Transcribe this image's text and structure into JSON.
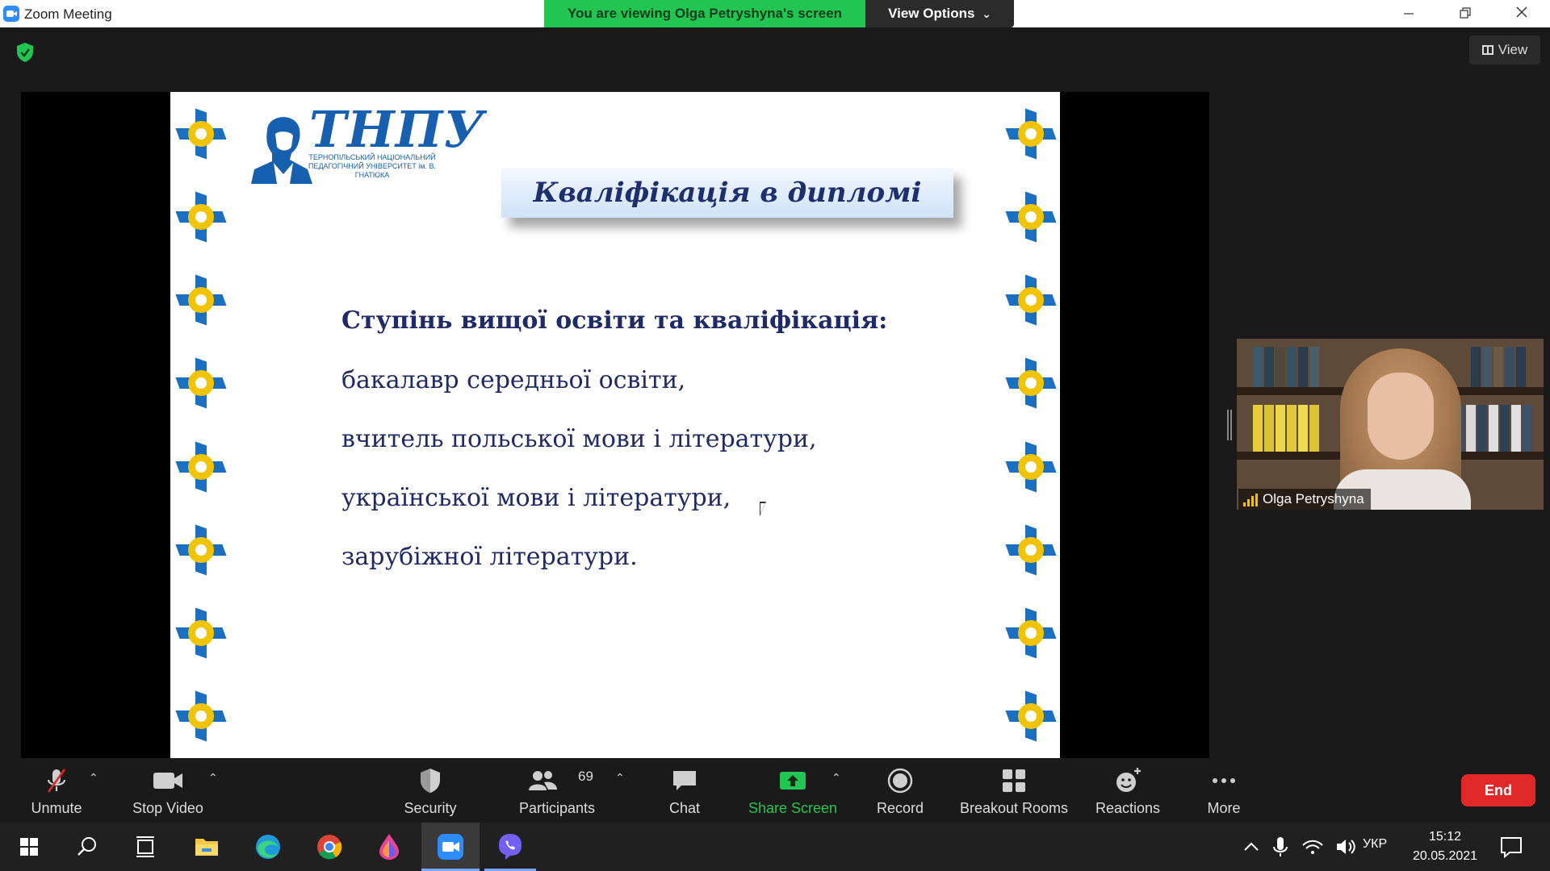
{
  "window": {
    "title": "Zoom Meeting",
    "banner": "You are viewing Olga Petryshyna's screen",
    "view_options": "View Options",
    "chevron": "⌄"
  },
  "meeting": {
    "view_label": "View"
  },
  "slide": {
    "logo_word": "ТНПУ",
    "logo_subtitle": "ТЕРНОПІЛЬСЬКИЙ НАЦІОНАЛЬНИЙ ПЕДАГОГІЧНИЙ УНІВЕРСИТЕТ ім. В. ГНАТЮКА",
    "title": "Кваліфікація в дипломі",
    "heading": "Ступінь вищої освіти та кваліфікація:",
    "lines": [
      "бакалавр середньої освіти,",
      "вчитель польської мови і літератури,",
      "української мови і літератури,",
      "зарубіжної літератури."
    ]
  },
  "participant": {
    "name": "Olga Petryshyna"
  },
  "toolbar": {
    "unmute": "Unmute",
    "stop_video": "Stop Video",
    "security": "Security",
    "participants": "Participants",
    "participants_count": "69",
    "chat": "Chat",
    "share_screen": "Share Screen",
    "record": "Record",
    "breakout_rooms": "Breakout Rooms",
    "reactions": "Reactions",
    "more": "More",
    "end": "End"
  },
  "taskbar": {
    "language": "УКР",
    "time": "15:12",
    "date": "20.05.2021"
  },
  "colors": {
    "banner_green": "#23c552",
    "end_red": "#e02828",
    "ornament_blue": "#1b6fc0",
    "ornament_yellow": "#f2c400"
  }
}
